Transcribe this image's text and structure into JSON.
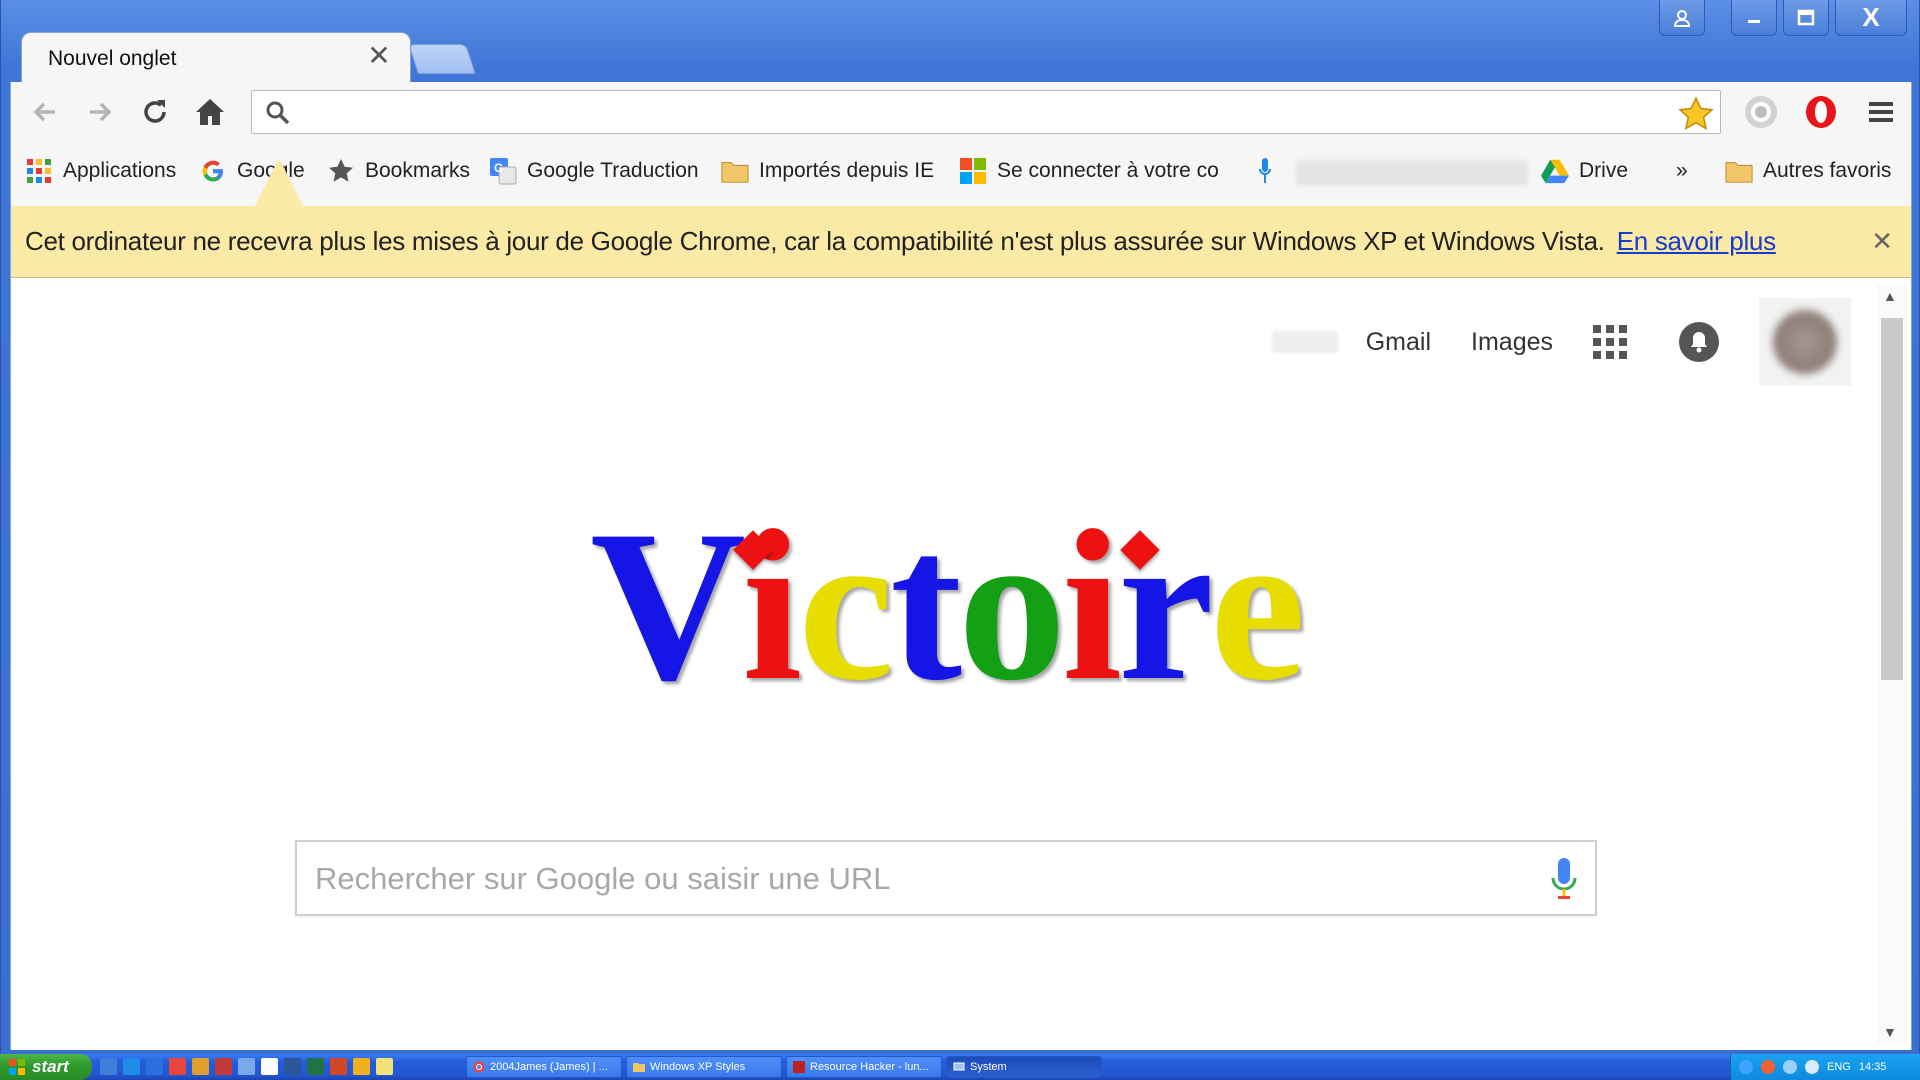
{
  "tab": {
    "title": "Nouvel onglet",
    "close": "✕"
  },
  "window_controls": {
    "close": "X"
  },
  "omnibox": {
    "value": ""
  },
  "bookmarks": [
    {
      "label": "Applications",
      "icon": "apps-grid-icon"
    },
    {
      "label": "Google",
      "icon": "google-g-icon"
    },
    {
      "label": "Bookmarks",
      "icon": "star-icon"
    },
    {
      "label": "Google Traduction",
      "icon": "translate-icon"
    },
    {
      "label": "Importés depuis IE",
      "icon": "folder-icon"
    },
    {
      "label": "Se connecter à votre co",
      "icon": "microsoft-icon"
    },
    {
      "label": "Drive",
      "icon": "drive-icon"
    },
    {
      "label": "Autres favoris",
      "icon": "folder-icon"
    }
  ],
  "bookmarks_overflow": "»",
  "infobar": {
    "message": "Cet ordinateur ne recevra plus les mises à jour de Google Chrome, car la compatibilité n'est plus assurée sur Windows XP et Windows Vista.",
    "link": "En savoir plus",
    "close": "✕"
  },
  "page": {
    "links": {
      "gmail": "Gmail",
      "images": "Images"
    },
    "logo": {
      "letters": [
        "V",
        "i",
        "c",
        "t",
        "o",
        "i",
        "r",
        "e"
      ],
      "colors": [
        "#1515e6",
        "#ee1111",
        "#e8dd00",
        "#1515e6",
        "#14a014",
        "#ee1111",
        "#1515e6",
        "#e8dd00"
      ]
    },
    "search": {
      "placeholder": "Rechercher sur Google ou saisir une URL"
    }
  },
  "taskbar": {
    "start": "start",
    "tasks": [
      {
        "label": "2004James (James) | ...",
        "icon": "chrome-icon"
      },
      {
        "label": "Windows XP Styles",
        "icon": "folder-icon"
      },
      {
        "label": "Resource Hacker - lun...",
        "icon": "resource-hacker-icon"
      },
      {
        "label": "System",
        "icon": "system-icon"
      }
    ],
    "tray": {
      "lang": "ENG",
      "time": "14:35"
    }
  }
}
